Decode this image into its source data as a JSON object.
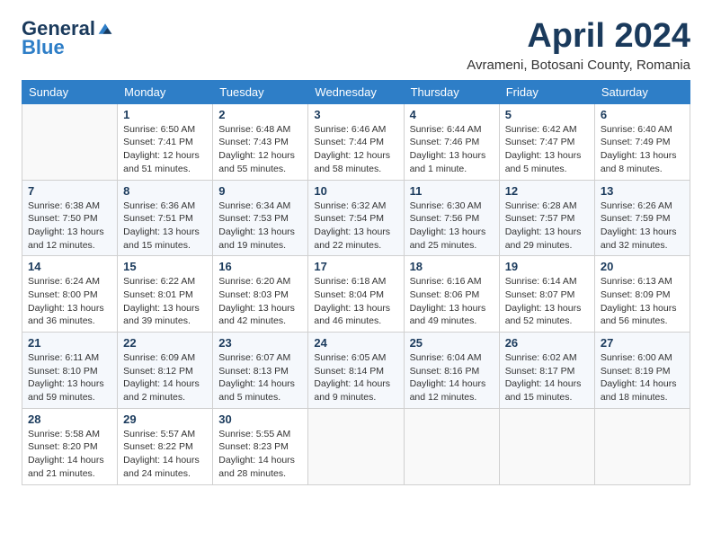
{
  "header": {
    "logo_general": "General",
    "logo_blue": "Blue",
    "month_title": "April 2024",
    "subtitle": "Avrameni, Botosani County, Romania"
  },
  "days_of_week": [
    "Sunday",
    "Monday",
    "Tuesday",
    "Wednesday",
    "Thursday",
    "Friday",
    "Saturday"
  ],
  "weeks": [
    [
      {
        "day": "",
        "info": ""
      },
      {
        "day": "1",
        "info": "Sunrise: 6:50 AM\nSunset: 7:41 PM\nDaylight: 12 hours\nand 51 minutes."
      },
      {
        "day": "2",
        "info": "Sunrise: 6:48 AM\nSunset: 7:43 PM\nDaylight: 12 hours\nand 55 minutes."
      },
      {
        "day": "3",
        "info": "Sunrise: 6:46 AM\nSunset: 7:44 PM\nDaylight: 12 hours\nand 58 minutes."
      },
      {
        "day": "4",
        "info": "Sunrise: 6:44 AM\nSunset: 7:46 PM\nDaylight: 13 hours\nand 1 minute."
      },
      {
        "day": "5",
        "info": "Sunrise: 6:42 AM\nSunset: 7:47 PM\nDaylight: 13 hours\nand 5 minutes."
      },
      {
        "day": "6",
        "info": "Sunrise: 6:40 AM\nSunset: 7:49 PM\nDaylight: 13 hours\nand 8 minutes."
      }
    ],
    [
      {
        "day": "7",
        "info": "Sunrise: 6:38 AM\nSunset: 7:50 PM\nDaylight: 13 hours\nand 12 minutes."
      },
      {
        "day": "8",
        "info": "Sunrise: 6:36 AM\nSunset: 7:51 PM\nDaylight: 13 hours\nand 15 minutes."
      },
      {
        "day": "9",
        "info": "Sunrise: 6:34 AM\nSunset: 7:53 PM\nDaylight: 13 hours\nand 19 minutes."
      },
      {
        "day": "10",
        "info": "Sunrise: 6:32 AM\nSunset: 7:54 PM\nDaylight: 13 hours\nand 22 minutes."
      },
      {
        "day": "11",
        "info": "Sunrise: 6:30 AM\nSunset: 7:56 PM\nDaylight: 13 hours\nand 25 minutes."
      },
      {
        "day": "12",
        "info": "Sunrise: 6:28 AM\nSunset: 7:57 PM\nDaylight: 13 hours\nand 29 minutes."
      },
      {
        "day": "13",
        "info": "Sunrise: 6:26 AM\nSunset: 7:59 PM\nDaylight: 13 hours\nand 32 minutes."
      }
    ],
    [
      {
        "day": "14",
        "info": "Sunrise: 6:24 AM\nSunset: 8:00 PM\nDaylight: 13 hours\nand 36 minutes."
      },
      {
        "day": "15",
        "info": "Sunrise: 6:22 AM\nSunset: 8:01 PM\nDaylight: 13 hours\nand 39 minutes."
      },
      {
        "day": "16",
        "info": "Sunrise: 6:20 AM\nSunset: 8:03 PM\nDaylight: 13 hours\nand 42 minutes."
      },
      {
        "day": "17",
        "info": "Sunrise: 6:18 AM\nSunset: 8:04 PM\nDaylight: 13 hours\nand 46 minutes."
      },
      {
        "day": "18",
        "info": "Sunrise: 6:16 AM\nSunset: 8:06 PM\nDaylight: 13 hours\nand 49 minutes."
      },
      {
        "day": "19",
        "info": "Sunrise: 6:14 AM\nSunset: 8:07 PM\nDaylight: 13 hours\nand 52 minutes."
      },
      {
        "day": "20",
        "info": "Sunrise: 6:13 AM\nSunset: 8:09 PM\nDaylight: 13 hours\nand 56 minutes."
      }
    ],
    [
      {
        "day": "21",
        "info": "Sunrise: 6:11 AM\nSunset: 8:10 PM\nDaylight: 13 hours\nand 59 minutes."
      },
      {
        "day": "22",
        "info": "Sunrise: 6:09 AM\nSunset: 8:12 PM\nDaylight: 14 hours\nand 2 minutes."
      },
      {
        "day": "23",
        "info": "Sunrise: 6:07 AM\nSunset: 8:13 PM\nDaylight: 14 hours\nand 5 minutes."
      },
      {
        "day": "24",
        "info": "Sunrise: 6:05 AM\nSunset: 8:14 PM\nDaylight: 14 hours\nand 9 minutes."
      },
      {
        "day": "25",
        "info": "Sunrise: 6:04 AM\nSunset: 8:16 PM\nDaylight: 14 hours\nand 12 minutes."
      },
      {
        "day": "26",
        "info": "Sunrise: 6:02 AM\nSunset: 8:17 PM\nDaylight: 14 hours\nand 15 minutes."
      },
      {
        "day": "27",
        "info": "Sunrise: 6:00 AM\nSunset: 8:19 PM\nDaylight: 14 hours\nand 18 minutes."
      }
    ],
    [
      {
        "day": "28",
        "info": "Sunrise: 5:58 AM\nSunset: 8:20 PM\nDaylight: 14 hours\nand 21 minutes."
      },
      {
        "day": "29",
        "info": "Sunrise: 5:57 AM\nSunset: 8:22 PM\nDaylight: 14 hours\nand 24 minutes."
      },
      {
        "day": "30",
        "info": "Sunrise: 5:55 AM\nSunset: 8:23 PM\nDaylight: 14 hours\nand 28 minutes."
      },
      {
        "day": "",
        "info": ""
      },
      {
        "day": "",
        "info": ""
      },
      {
        "day": "",
        "info": ""
      },
      {
        "day": "",
        "info": ""
      }
    ]
  ]
}
